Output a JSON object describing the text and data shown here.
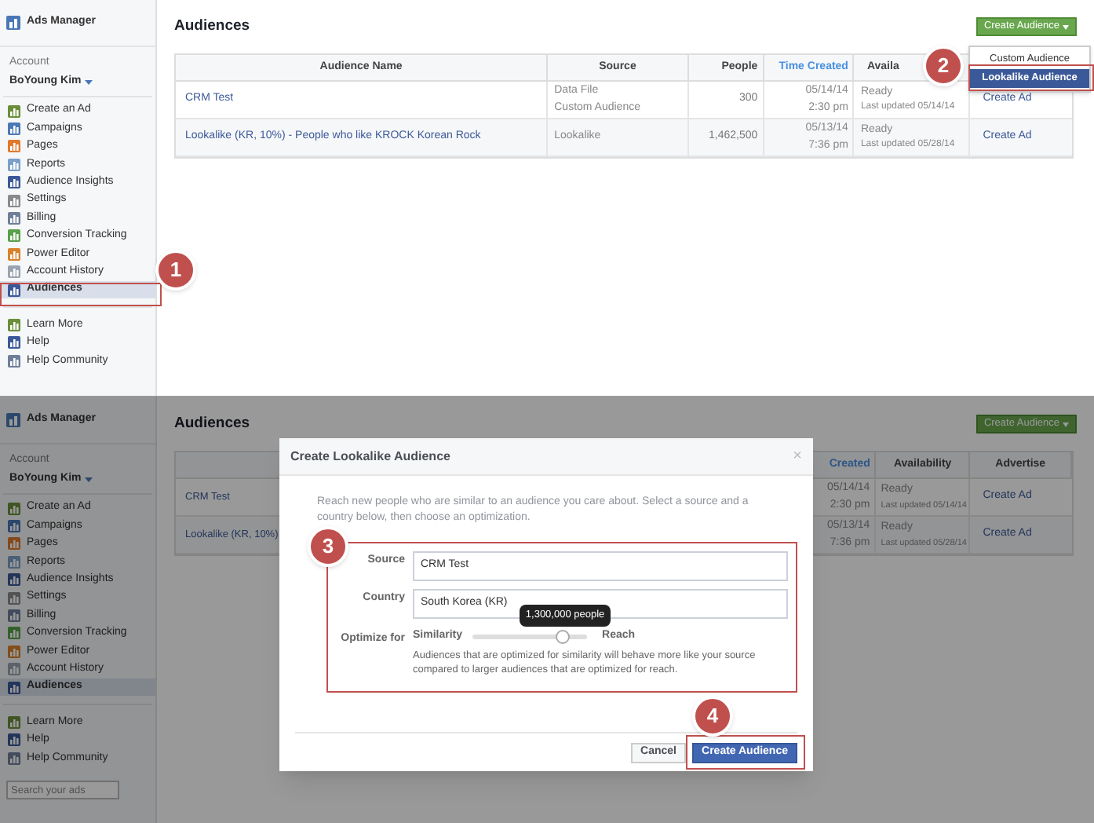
{
  "panels": [
    {
      "dimmed": false,
      "sidebar": {
        "app_title": "Ads Manager",
        "account_label": "Account",
        "account_name": "BoYoung Kim",
        "items": [
          {
            "label": "Create an Ad",
            "selected": false
          },
          {
            "label": "Campaigns",
            "selected": false
          },
          {
            "label": "Pages",
            "selected": false
          },
          {
            "label": "Reports",
            "selected": false
          },
          {
            "label": "Audience Insights",
            "selected": false
          },
          {
            "label": "Settings",
            "selected": false
          },
          {
            "label": "Billing",
            "selected": false
          },
          {
            "label": "Conversion Tracking",
            "selected": false
          },
          {
            "label": "Power Editor",
            "selected": false
          },
          {
            "label": "Account History",
            "selected": false
          },
          {
            "label": "Audiences",
            "selected": true
          }
        ],
        "secondary_items": [
          {
            "label": "Learn More"
          },
          {
            "label": "Help"
          },
          {
            "label": "Help Community"
          }
        ]
      },
      "main": {
        "title": "Audiences",
        "create_button": "Create Audience",
        "menu": {
          "items": [
            {
              "label": "Custom Audience",
              "selected": false
            },
            {
              "label": "Lookalike Audience",
              "selected": true
            }
          ]
        },
        "table": {
          "kind": "full",
          "columns": [
            {
              "label": "Audience Name",
              "sorted": false
            },
            {
              "label": "Source",
              "sorted": false
            },
            {
              "label": "People",
              "sorted": false
            },
            {
              "label": "Time Created",
              "sorted": true
            },
            {
              "label": "Availa",
              "sorted": false
            }
          ],
          "rows": [
            {
              "name": "CRM Test",
              "source": [
                "Data File",
                "Custom Audience"
              ],
              "people": "300",
              "date": "05/14/14",
              "time": "2:30 pm",
              "status": "Ready",
              "updated": "Last updated 05/14/14",
              "action": "Create Ad"
            },
            {
              "name": "Lookalike (KR, 10%) - People who like KROCK Korean Rock",
              "source": [
                "Lookalike"
              ],
              "people": "1,462,500",
              "date": "05/13/14",
              "time": "7:36 pm",
              "status": "Ready",
              "updated": "Last updated 05/28/14",
              "action": "Create Ad"
            }
          ]
        }
      },
      "callouts": [
        {
          "number": "1",
          "kind": "sidebar"
        },
        {
          "number": "2",
          "kind": "menu"
        }
      ]
    },
    {
      "dimmed": true,
      "sidebar": {
        "app_title": "Ads Manager",
        "account_label": "Account",
        "account_name": "BoYoung Kim",
        "items": [
          {
            "label": "Create an Ad",
            "selected": false
          },
          {
            "label": "Campaigns",
            "selected": false
          },
          {
            "label": "Pages",
            "selected": false
          },
          {
            "label": "Reports",
            "selected": false
          },
          {
            "label": "Audience Insights",
            "selected": false
          },
          {
            "label": "Settings",
            "selected": false
          },
          {
            "label": "Billing",
            "selected": false
          },
          {
            "label": "Conversion Tracking",
            "selected": false
          },
          {
            "label": "Power Editor",
            "selected": false
          },
          {
            "label": "Account History",
            "selected": false
          },
          {
            "label": "Audiences",
            "selected": true
          }
        ],
        "secondary_items": [
          {
            "label": "Learn More"
          },
          {
            "label": "Help"
          },
          {
            "label": "Help Community"
          }
        ],
        "search": {
          "placeholder": "Search your ads"
        }
      },
      "main": {
        "title": "Audiences",
        "create_button": "Create Audience",
        "table": {
          "kind": "partial",
          "columns": [
            {
              "label": "Created",
              "sorted": true
            },
            {
              "label": "Availability",
              "sorted": false
            },
            {
              "label": "Advertise",
              "sorted": false
            }
          ],
          "rows": [
            {
              "name": "CRM Test",
              "date": "05/14/14",
              "time": "2:30 pm",
              "status": "Ready",
              "updated": "Last updated 05/14/14",
              "action": "Create Ad"
            },
            {
              "name": "Lookalike (KR, 10%)",
              "date": "05/13/14",
              "time": "7:36 pm",
              "status": "Ready",
              "updated": "Last updated 05/28/14",
              "action": "Create Ad"
            }
          ]
        }
      },
      "dialog": {
        "title": "Create Lookalike Audience",
        "close": "×",
        "intro": "Reach new people who are similar to an audience you care about. Select a source and a country below, then choose an optimization.",
        "fields": [
          {
            "label": "Source",
            "value": "CRM Test"
          },
          {
            "label": "Country",
            "value": "South Korea (KR)"
          }
        ],
        "optimize": {
          "label": "Optimize for",
          "min_label": "Similarity",
          "max_label": "Reach",
          "level": 0.8,
          "tooltip": "1,300,000 people",
          "help": "Audiences that are optimized for similarity will behave more like your source compared to larger audiences that are optimized for reach."
        },
        "buttons": [
          {
            "label": "Cancel",
            "kind": "secondary"
          },
          {
            "label": "Create Audience",
            "kind": "primary"
          }
        ]
      },
      "callouts": [
        {
          "number": "3",
          "kind": "form"
        },
        {
          "number": "4",
          "kind": "button"
        }
      ]
    }
  ]
}
